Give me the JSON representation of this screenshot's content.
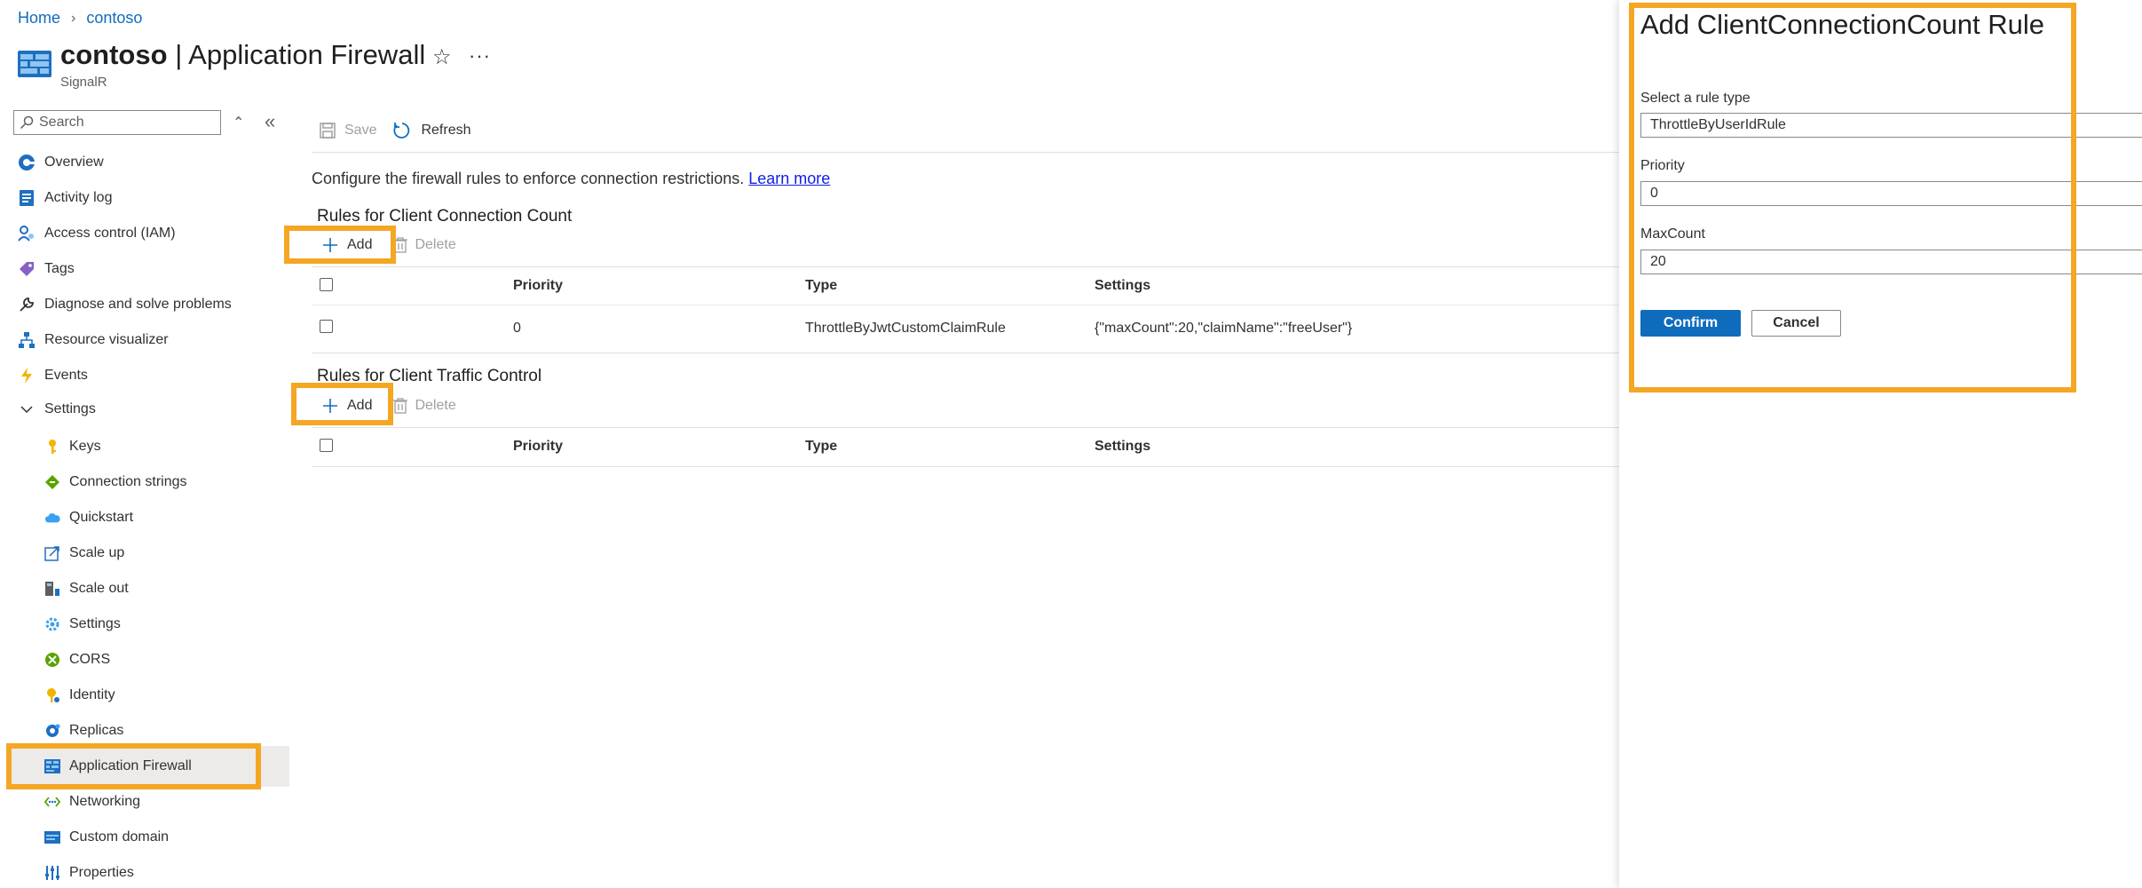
{
  "breadcrumb": {
    "home": "Home",
    "current": "contoso"
  },
  "header": {
    "resource_name": "contoso",
    "separator": "|",
    "page_title": "Application Firewall",
    "subtitle": "SignalR",
    "icons": [
      "firewall-resource-icon",
      "star-icon",
      "more-icon"
    ]
  },
  "sidebar": {
    "search_placeholder": "Search",
    "items": [
      {
        "label": "Overview",
        "icon": "overview-icon"
      },
      {
        "label": "Activity log",
        "icon": "activity-log-icon"
      },
      {
        "label": "Access control (IAM)",
        "icon": "iam-icon"
      },
      {
        "label": "Tags",
        "icon": "tag-icon"
      },
      {
        "label": "Diagnose and solve problems",
        "icon": "wrench-icon"
      },
      {
        "label": "Resource visualizer",
        "icon": "resource-visualizer-icon"
      },
      {
        "label": "Events",
        "icon": "lightning-icon"
      },
      {
        "label": "Settings",
        "icon": "chevron-down-icon"
      },
      {
        "label": "Keys",
        "icon": "key-icon"
      },
      {
        "label": "Connection strings",
        "icon": "connection-strings-icon"
      },
      {
        "label": "Quickstart",
        "icon": "cloud-icon"
      },
      {
        "label": "Scale up",
        "icon": "scale-up-icon"
      },
      {
        "label": "Scale out",
        "icon": "scale-out-icon"
      },
      {
        "label": "Settings",
        "icon": "gear-icon"
      },
      {
        "label": "CORS",
        "icon": "cors-icon"
      },
      {
        "label": "Identity",
        "icon": "identity-icon"
      },
      {
        "label": "Replicas",
        "icon": "replicas-icon"
      },
      {
        "label": "Application Firewall",
        "icon": "firewall-icon"
      },
      {
        "label": "Networking",
        "icon": "networking-icon"
      },
      {
        "label": "Custom domain",
        "icon": "custom-domain-icon"
      },
      {
        "label": "Properties",
        "icon": "properties-icon"
      }
    ]
  },
  "toolbar": {
    "save": "Save",
    "refresh": "Refresh"
  },
  "main": {
    "description": "Configure the firewall rules to enforce connection restrictions.",
    "learn_more": "Learn more",
    "connection_section": {
      "title": "Rules for Client Connection Count",
      "add": "Add",
      "delete": "Delete",
      "columns": [
        "Priority",
        "Type",
        "Settings"
      ],
      "rows": [
        {
          "priority": "0",
          "type": "ThrottleByJwtCustomClaimRule",
          "settings": "{\"maxCount\":20,\"claimName\":\"freeUser\"}"
        }
      ]
    },
    "traffic_section": {
      "title": "Rules for Client Traffic Control",
      "add": "Add",
      "delete": "Delete",
      "columns": [
        "Priority",
        "Type",
        "Settings"
      ]
    }
  },
  "panel": {
    "title": "Add ClientConnectionCount Rule",
    "rule_type_label": "Select a rule type",
    "rule_type_value": "ThrottleByUserIdRule",
    "priority_label": "Priority",
    "priority_value": "0",
    "maxcount_label": "MaxCount",
    "maxcount_value": "20",
    "confirm": "Confirm",
    "cancel": "Cancel"
  },
  "colors": {
    "highlight": "#f5a623",
    "accent": "#0f6cbd",
    "link": "#0f1ee8"
  }
}
